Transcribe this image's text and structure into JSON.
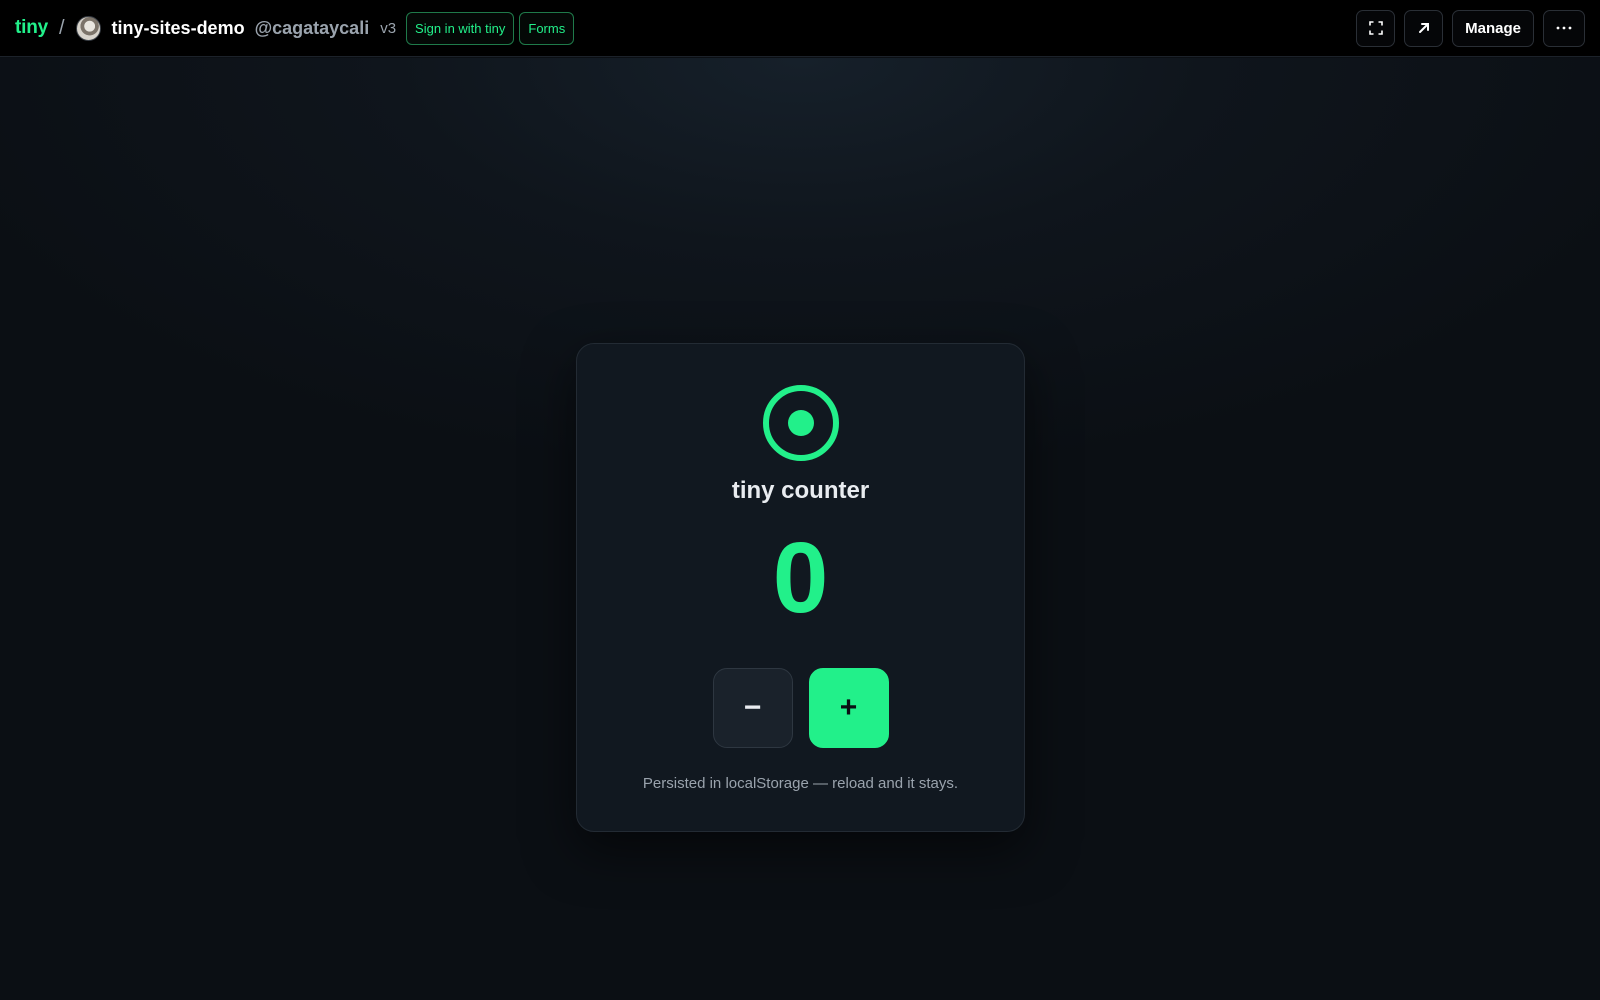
{
  "topbar": {
    "brand": "tiny",
    "separator": "/",
    "project": "tiny-sites-demo",
    "owner": "@cagataycali",
    "version": "v3",
    "pills": [
      "Sign in with tiny",
      "Forms"
    ],
    "manage_label": "Manage",
    "icons": [
      "fullscreen-icon",
      "open-external-icon",
      "more-icon"
    ]
  },
  "card": {
    "icon": "target-icon",
    "title": "tiny counter",
    "count": "0",
    "decrement_label": "−",
    "increment_label": "+",
    "note": "Persisted in localStorage — reload and it stays."
  },
  "colors": {
    "accent": "#22f08a",
    "background": "#0b0f14",
    "card": "#111820"
  }
}
